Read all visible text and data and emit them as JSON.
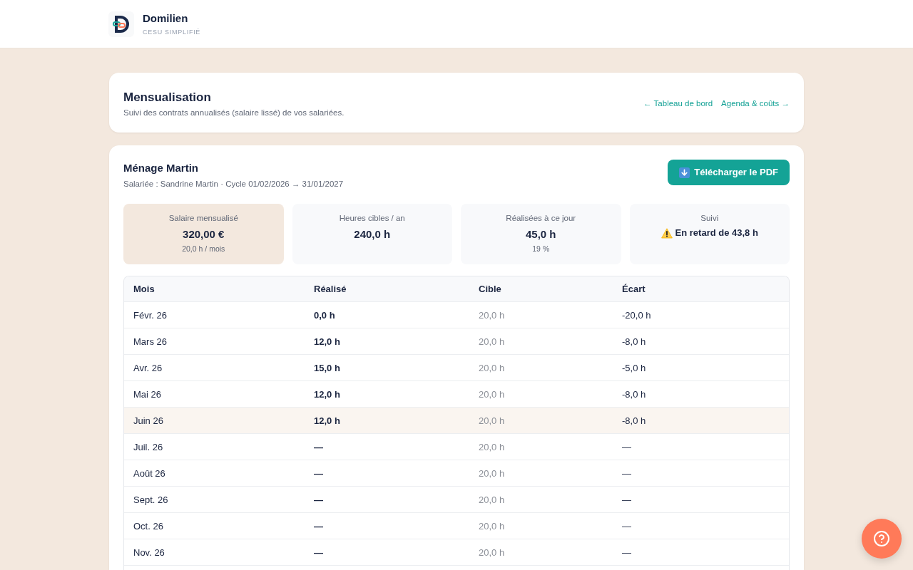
{
  "header": {
    "brand": "Domilien",
    "tagline": "CESU SIMPLIFIÉ"
  },
  "page_header": {
    "title": "Mensualisation",
    "subtitle": "Suivi des contrats annualisés (salaire lissé) de vos salariées.",
    "links": [
      "← Tableau de bord",
      "Agenda & coûts →"
    ]
  },
  "contract": {
    "title": "Ménage Martin",
    "subtitle": "Salariée : Sandrine Martin · Cycle 01/02/2026 → 31/01/2027",
    "download_button": "Télécharger le PDF",
    "stats": [
      {
        "kind": "metric",
        "label": "Salaire mensualisé",
        "value": "320,00 €",
        "note": "20,0 h / mois",
        "highlighted": true
      },
      {
        "kind": "metric",
        "label": "Heures cibles / an",
        "value": "240,0 h",
        "highlighted": false
      },
      {
        "kind": "metric",
        "label": "Réalisées à ce jour",
        "value": "45,0 h",
        "note": "19 %",
        "highlighted": false
      },
      {
        "kind": "warning",
        "label": "Suivi",
        "value": "En retard de 43,8 h",
        "highlighted": false
      }
    ],
    "table": {
      "columns": [
        "Mois",
        "Réalisé",
        "Cible",
        "Écart"
      ],
      "rows": [
        {
          "cells": [
            "Févr. 26",
            "0,0 h",
            "20,0 h",
            "-20,0 h"
          ],
          "current": false
        },
        {
          "cells": [
            "Mars 26",
            "12,0 h",
            "20,0 h",
            "-8,0 h"
          ],
          "current": false
        },
        {
          "cells": [
            "Avr. 26",
            "15,0 h",
            "20,0 h",
            "-5,0 h"
          ],
          "current": false
        },
        {
          "cells": [
            "Mai 26",
            "12,0 h",
            "20,0 h",
            "-8,0 h"
          ],
          "current": false
        },
        {
          "cells": [
            "Juin 26",
            "12,0 h",
            "20,0 h",
            "-8,0 h"
          ],
          "current": true
        },
        {
          "cells": [
            "Juil. 26",
            "—",
            "20,0 h",
            "—"
          ],
          "current": false
        },
        {
          "cells": [
            "Août 26",
            "—",
            "20,0 h",
            "—"
          ],
          "current": false
        },
        {
          "cells": [
            "Sept. 26",
            "—",
            "20,0 h",
            "—"
          ],
          "current": false
        },
        {
          "cells": [
            "Oct. 26",
            "—",
            "20,0 h",
            "—"
          ],
          "current": false
        },
        {
          "cells": [
            "Nov. 26",
            "—",
            "20,0 h",
            "—"
          ],
          "current": false
        }
      ]
    }
  }
}
